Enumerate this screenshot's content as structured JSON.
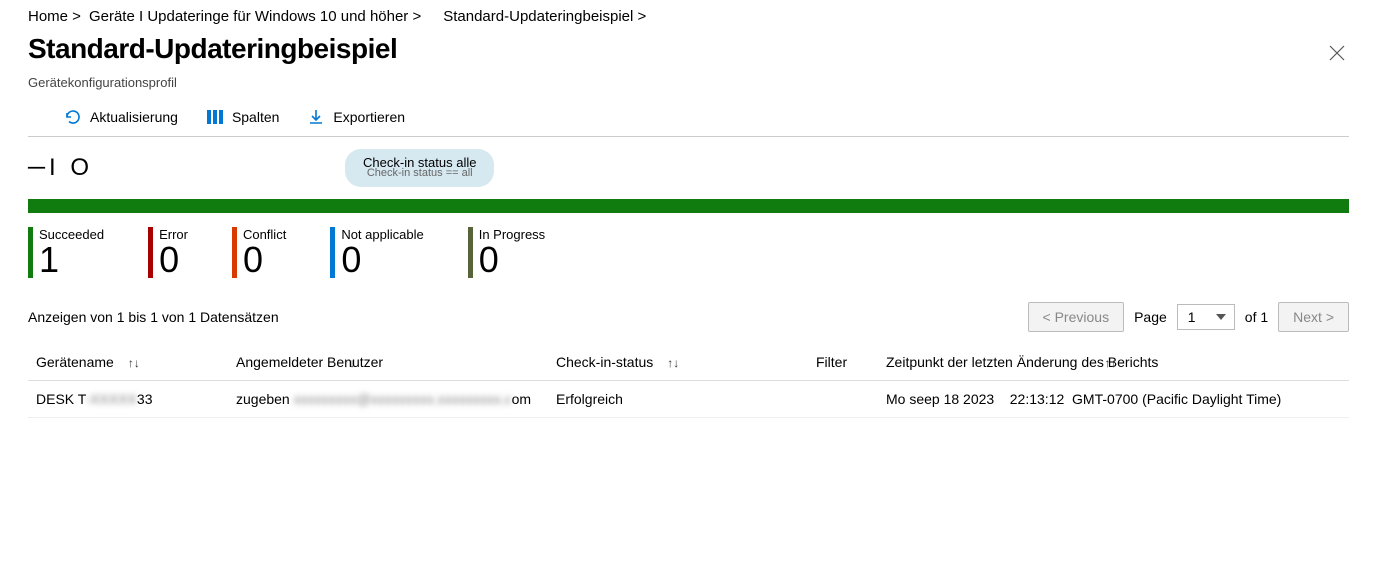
{
  "breadcrumb": [
    {
      "label": "Home >"
    },
    {
      "label": "Geräte I Updateringe für Windows 10 und höher >"
    },
    {
      "label": "Standard-Updateringbeispiel >"
    }
  ],
  "title": "Standard-Updateringbeispiel",
  "subtitle": "Gerätekonfigurationsprofil",
  "toolbar": {
    "refresh": "Aktualisierung",
    "columns": "Spalten",
    "export": "Exportieren"
  },
  "pill": {
    "top": "Check-in status alle",
    "bot": "Check-in status == all"
  },
  "stats": [
    {
      "label": "Succeeded",
      "value": "1",
      "color": "c-green"
    },
    {
      "label": "Error",
      "value": "0",
      "color": "c-red"
    },
    {
      "label": "Conflict",
      "value": "0",
      "color": "c-orange"
    },
    {
      "label": "Not applicable",
      "value": "0",
      "color": "c-blue"
    },
    {
      "label": "In Progress",
      "value": "0",
      "color": "c-olive"
    }
  ],
  "records_text": "Anzeigen von 1 bis 1 von 1 Datensätzen",
  "pager": {
    "prev": "<  Previous",
    "page_label": "Page",
    "page_val": "1",
    "of_label": "of 1",
    "next": "Next  >"
  },
  "table": {
    "headers": {
      "device": "Gerätename",
      "user": "Angemeldeter Benutzer",
      "status": "Check-in-status",
      "filter": "Filter",
      "time": "Zeitpunkt der letzten Änderung des Berichts"
    },
    "rows": [
      {
        "device_prefix": "DESK T",
        "device_blur": "-XXXXX",
        "device_suffix": "33",
        "user_prefix": "zugeben",
        "user_blur": "xxxxxxxxx@xxxxxxxxx.xxxxxxxxx.c",
        "user_suffix": "om",
        "status": "Erfolgreich",
        "filter": "",
        "time_date": "Mo seep 18 2023",
        "time_clock": "22:13:12",
        "time_tz": "GMT-0700 (Pacific Daylight Time)"
      }
    ]
  }
}
